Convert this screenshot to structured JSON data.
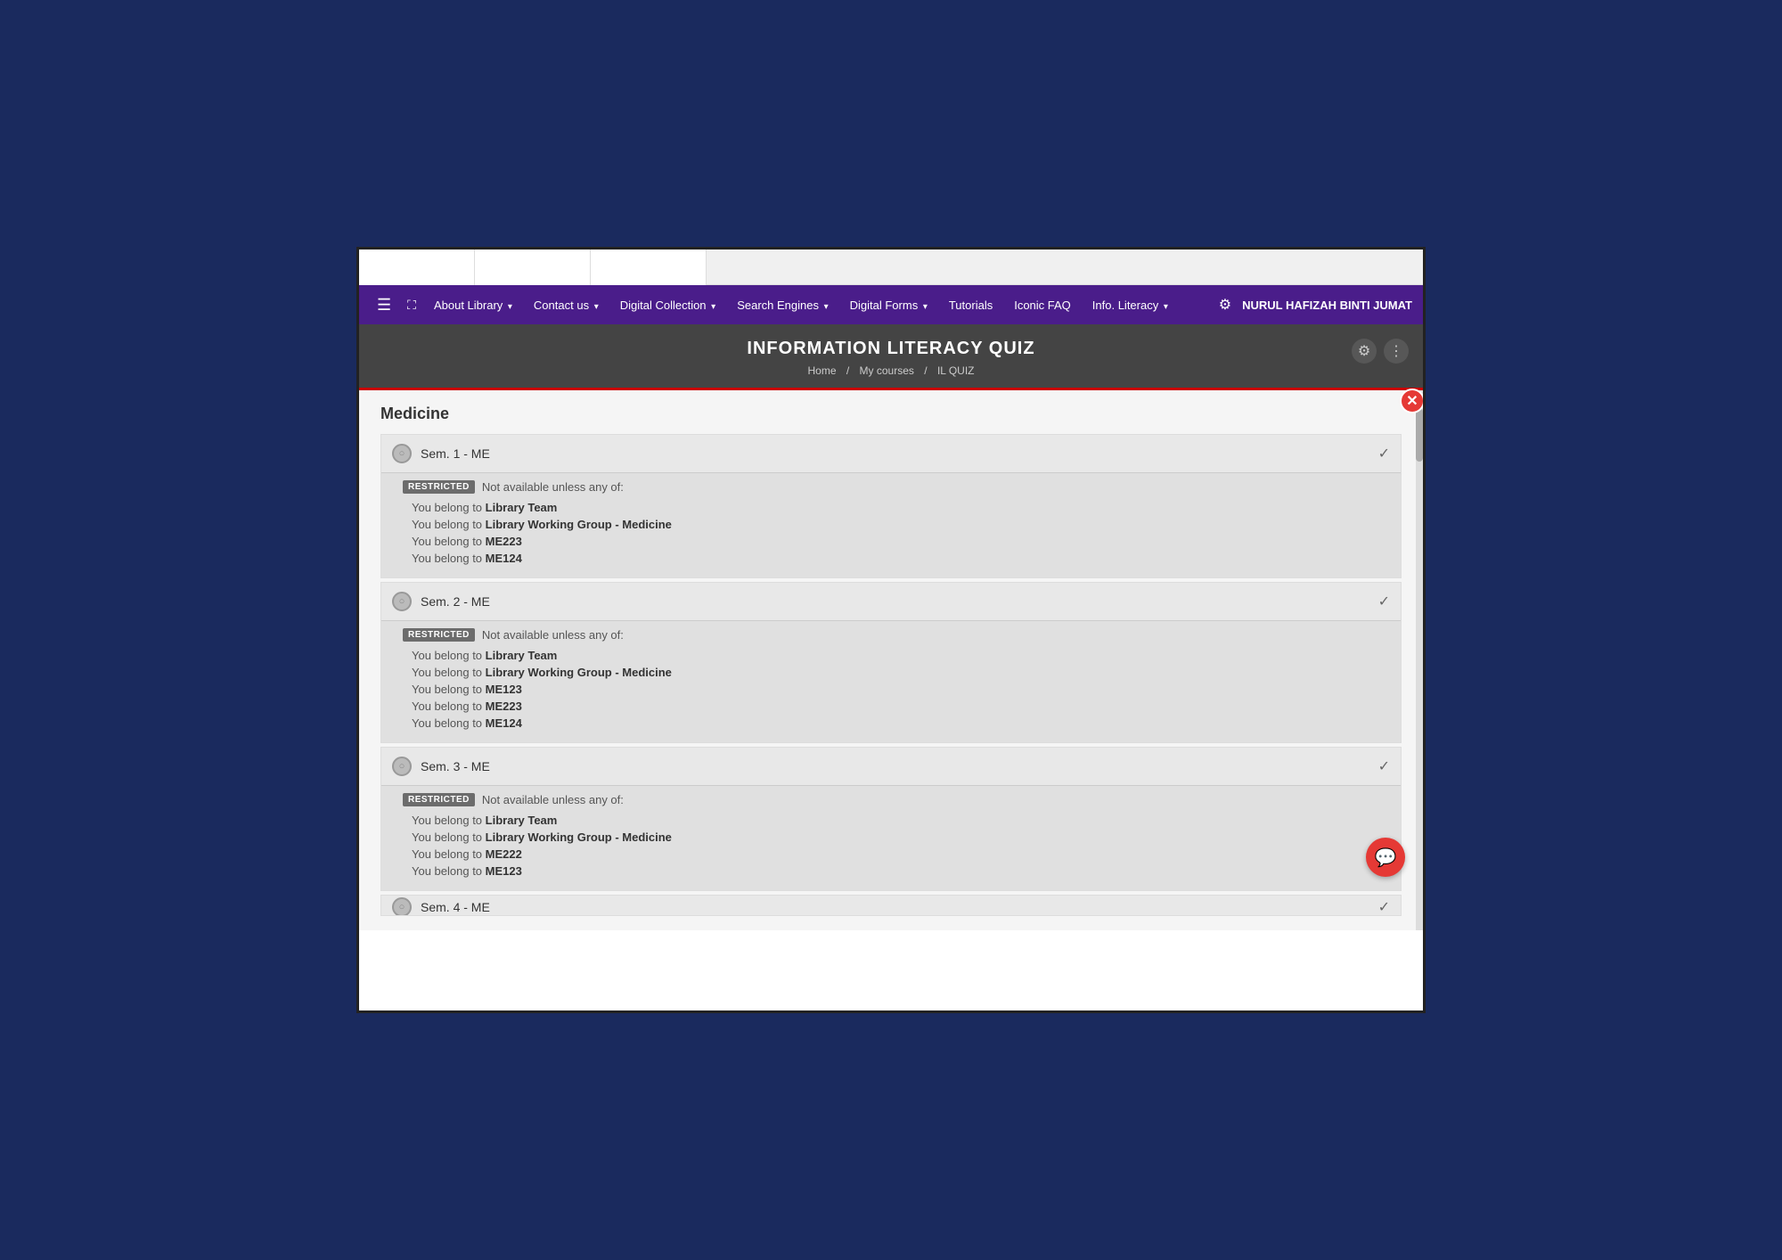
{
  "navbar": {
    "hamburger": "☰",
    "expand": "⛶",
    "items": [
      {
        "label": "About Library",
        "hasArrow": true
      },
      {
        "label": "Contact us",
        "hasArrow": true
      },
      {
        "label": "Digital Collection",
        "hasArrow": true
      },
      {
        "label": "Search Engines",
        "hasArrow": true
      },
      {
        "label": "Digital Forms",
        "hasArrow": true
      },
      {
        "label": "Tutorials",
        "hasArrow": false
      },
      {
        "label": "Iconic FAQ",
        "hasArrow": false
      },
      {
        "label": "Info. Literacy",
        "hasArrow": true
      }
    ],
    "settings_icon": "⚙",
    "username": "NURUL HAFIZAH BINTI JUMAT"
  },
  "course_header": {
    "title": "INFORMATION LITERACY QUIZ",
    "breadcrumb": {
      "home": "Home",
      "separator1": "/",
      "courses": "My courses",
      "separator2": "/",
      "quiz": "IL QUIZ"
    }
  },
  "section": {
    "title": "Medicine",
    "semesters": [
      {
        "label": "Sem. 1 - ME",
        "restricted_badge": "Restricted",
        "restriction_text": "Not available unless any of:",
        "conditions": [
          {
            "text": "You belong to ",
            "bold": "Library Team"
          },
          {
            "text": "You belong to ",
            "bold": "Library Working Group - Medicine"
          },
          {
            "text": "You belong to ",
            "bold": "ME223"
          },
          {
            "text": "You belong to ",
            "bold": "ME124"
          }
        ]
      },
      {
        "label": "Sem. 2 - ME",
        "restricted_badge": "Restricted",
        "restriction_text": "Not available unless any of:",
        "conditions": [
          {
            "text": "You belong to ",
            "bold": "Library Team"
          },
          {
            "text": "You belong to ",
            "bold": "Library Working Group - Medicine"
          },
          {
            "text": "You belong to ",
            "bold": "ME123"
          },
          {
            "text": "You belong to ",
            "bold": "ME223"
          },
          {
            "text": "You belong to ",
            "bold": "ME124"
          }
        ]
      },
      {
        "label": "Sem. 3 - ME",
        "restricted_badge": "Restricted",
        "restriction_text": "Not available unless any of:",
        "conditions": [
          {
            "text": "You belong to ",
            "bold": "Library Team"
          },
          {
            "text": "You belong to ",
            "bold": "Library Working Group - Medicine"
          },
          {
            "text": "You belong to ",
            "bold": "ME222"
          },
          {
            "text": "You belong to ",
            "bold": "ME123"
          }
        ]
      }
    ],
    "partial_label": "Sem. 4 - ME"
  },
  "close_button": "✕",
  "chat_button": "💬"
}
